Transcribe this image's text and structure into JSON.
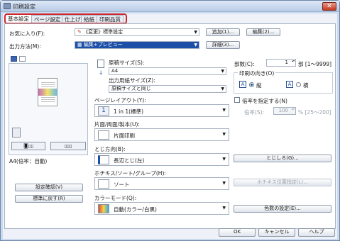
{
  "window": {
    "title": "印刷設定",
    "close_glyph": "✕"
  },
  "tabs": [
    {
      "label": "基本設定",
      "active": true
    },
    {
      "label": "ページ設定"
    },
    {
      "label": "仕上げ"
    },
    {
      "label": "給紙"
    },
    {
      "label": "印刷品質"
    }
  ],
  "favorites": {
    "label": "お気に入り(F):",
    "value": "《変更》標準設定",
    "add_button": "追加(1)...",
    "edit_button": "編集(2)..."
  },
  "output_method": {
    "label": "出力方法(M):",
    "value": "編集+プレビュー",
    "detail_button": "詳細(3)..."
  },
  "preview": {
    "caption": "A4(倍率：自動)",
    "settings_button": "設定確認(V)",
    "restore_button": "標準に戻す(R)"
  },
  "paper_size": {
    "label": "原稿サイズ(S):",
    "value": "A4"
  },
  "output_paper_size": {
    "label": "出力用紙サイズ(Z):",
    "value": "原稿サイズと同じ"
  },
  "copies": {
    "label": "部数(C):",
    "value": "1",
    "unit_range": "部 [1～9999]"
  },
  "orientation": {
    "label": "印刷の向き(O)",
    "options": [
      {
        "label": "縦",
        "selected": true
      },
      {
        "label": "横",
        "selected": false
      }
    ]
  },
  "page_layout": {
    "label": "ページレイアウト(Y):",
    "value": "1 in 1(標準)"
  },
  "duplex": {
    "label": "片面/両面/製本(U):",
    "value": "片面印刷"
  },
  "binding_location": {
    "label": "とじ方向(B):",
    "value": "長辺とじ(左)",
    "button": "とじしろ(G)..."
  },
  "zoom": {
    "label": "倍率を指定する(N)",
    "sub_label": "倍率(S):",
    "value": "100",
    "unit_range": "% [25～200]"
  },
  "staple": {
    "label": "ホチキス/ソート/グループ(H):",
    "value": "ソート",
    "button": "ホチキス位置指定(L)..."
  },
  "color_mode": {
    "label": "カラーモード(Q):",
    "value": "自動(カラー/白黒)",
    "button": "色数の設定(E)..."
  },
  "footer": {
    "ok": "OK",
    "cancel": "キャンセル",
    "help": "ヘルプ"
  },
  "colors": {
    "tab_highlight": "#d2262b",
    "output_selected": "#1c4fa8"
  }
}
